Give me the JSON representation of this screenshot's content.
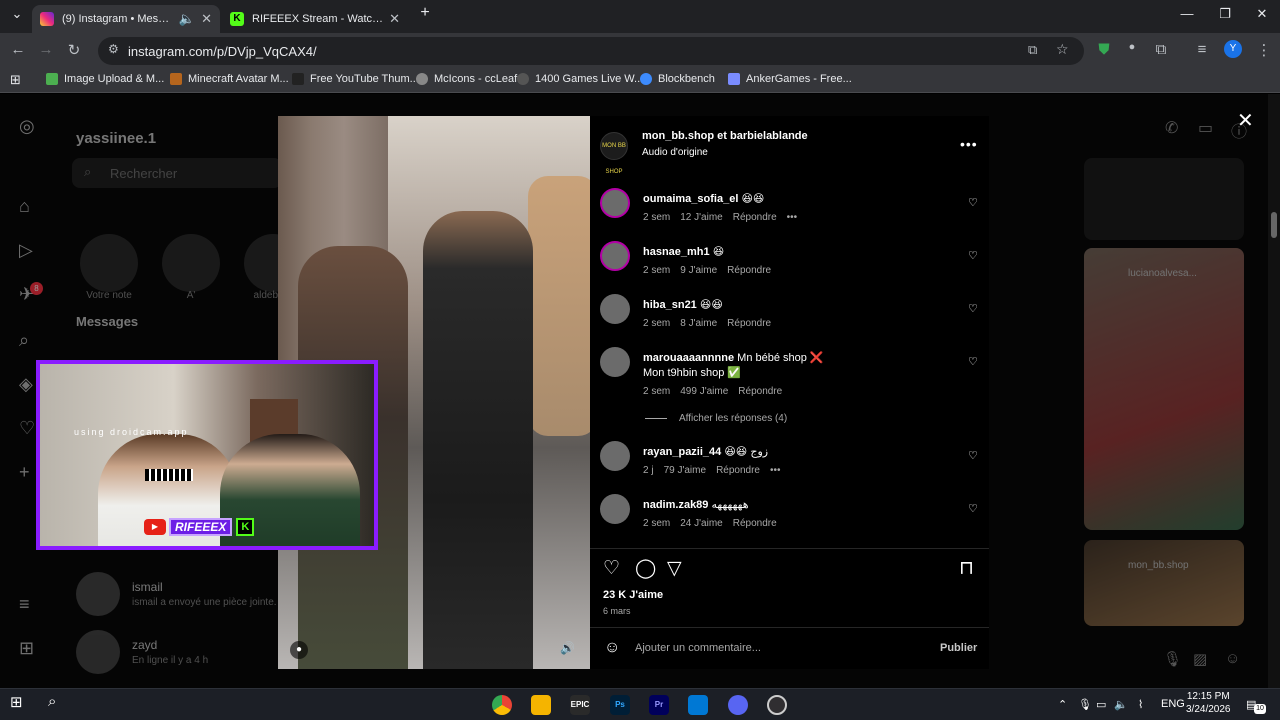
{
  "browser": {
    "tabs": [
      {
        "title": "(9) Instagram • Messages",
        "active": true
      },
      {
        "title": "RIFEEEX Stream - Watch Live on",
        "active": false
      }
    ],
    "url": "instagram.com/p/DVjp_VqCAX4/",
    "profile_initial": "Y",
    "bookmarks": [
      "Image Upload & M...",
      "Minecraft Avatar M...",
      "Free YouTube Thum...",
      "McIcons - ccLeaf",
      "1400 Games Live W...",
      "Blockbench",
      "AnkerGames - Free..."
    ]
  },
  "dm": {
    "username": "yassiinee.1",
    "search_placeholder": "Rechercher",
    "notes": [
      {
        "label": "Votre note"
      },
      {
        "label": "A'"
      },
      {
        "label": "aldebara"
      }
    ],
    "messages_title": "Messages",
    "threads": [
      {
        "name": "ismail",
        "preview": "ismail a envoyé une pièce jointe."
      },
      {
        "name": "zayd",
        "preview": "En ligne il y a 4 h"
      }
    ],
    "notif_count": "8"
  },
  "post": {
    "header_title": "mon_bb.shop et barbielablande",
    "header_sub": "Audio d'origine",
    "header_avatar_text": "MON BB SHOP",
    "comments": [
      {
        "user": "oumaima_sofia_el",
        "text": "😆😆",
        "age": "2 sem",
        "likes": "12 J'aime",
        "reply": "Répondre",
        "ring": true
      },
      {
        "user": "hasnae_mh1",
        "text": "😆",
        "age": "2 sem",
        "likes": "9 J'aime",
        "reply": "Répondre",
        "ring": true
      },
      {
        "user": "hiba_sn21",
        "text": "😆😆",
        "age": "2 sem",
        "likes": "8 J'aime",
        "reply": "Répondre",
        "ring": false
      },
      {
        "user": "marouaaaannnne",
        "text": "Mn bébé shop ❌",
        "text2": "Mon t9hbin shop ✅",
        "age": "2 sem",
        "likes": "499 J'aime",
        "reply": "Répondre",
        "ring": false
      },
      {
        "user": "rayan_pazii_44",
        "text": "😆😆 زوج",
        "age": "2 j",
        "likes": "79 J'aime",
        "reply": "Répondre",
        "ring": false
      },
      {
        "user": "nadim.zak89",
        "text": "ههههههه",
        "age": "2 sem",
        "likes": "24 J'aime",
        "reply": "Répondre",
        "ring": false
      }
    ],
    "view_replies": "Afficher les réponses (4)",
    "likes_total": "23 K J'aime",
    "date": "6 mars",
    "comment_placeholder": "Ajouter un commentaire...",
    "publish": "Publier",
    "suggested_labels": [
      "lucianoalvesa...",
      "mon_bb.shop"
    ]
  },
  "overlay": {
    "watermark": "using droidcam.app",
    "channel": "RIFEEEX"
  },
  "taskbar": {
    "lang": "ENG",
    "time": "12:15 PM",
    "date": "3/24/2026",
    "notif": "10"
  }
}
